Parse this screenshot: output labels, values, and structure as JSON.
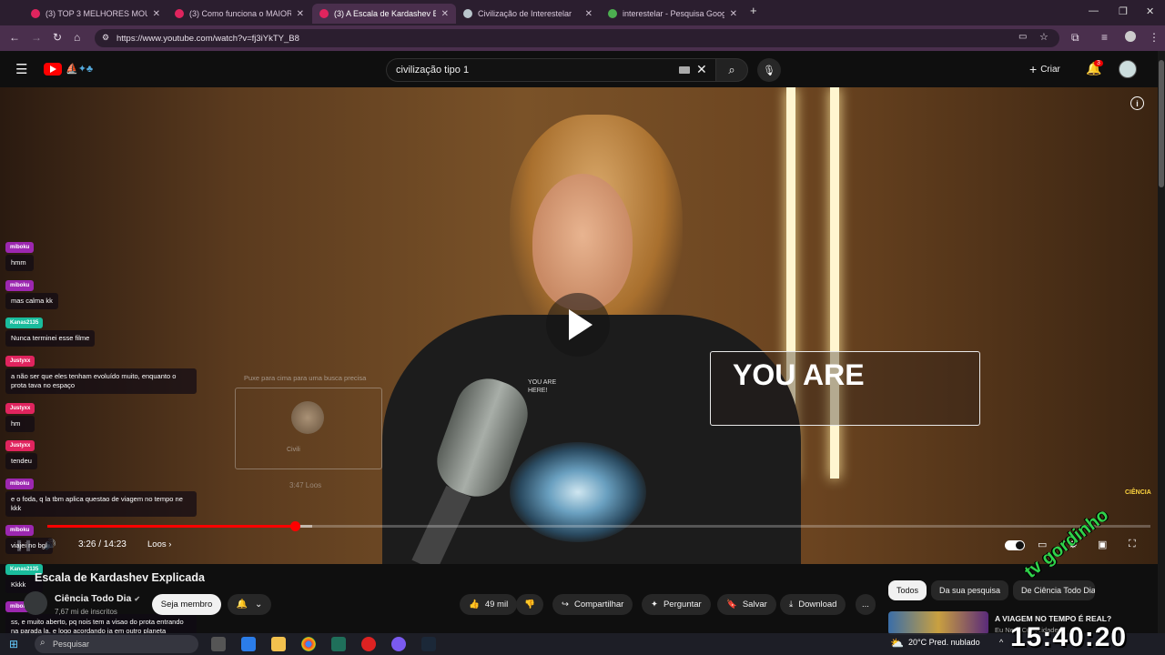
{
  "browser": {
    "tabs": [
      {
        "label": "(3) TOP 3 MELHORES MOUSES",
        "favicon_color": "#e0245e",
        "active": false
      },
      {
        "label": "(3) Como funciona o MAIOR TE",
        "favicon_color": "#e0245e",
        "active": false
      },
      {
        "label": "(3) A Escala de Kardashev E",
        "favicon_color": "#e0245e",
        "active": true
      },
      {
        "label": "Civilização de Interestelar",
        "favicon_color": "#b9c6cc",
        "active": false
      },
      {
        "label": "interestelar - Pesquisa Google",
        "favicon_color": "#4caf50",
        "active": false
      }
    ],
    "new_tab": "+",
    "url": "https://www.youtube.com/watch?v=fj3iYkTY_B8"
  },
  "youtube": {
    "search_value": "civilização tipo 1",
    "create_label": "Criar",
    "notification_count": "3"
  },
  "video": {
    "overlay_text": "YOU ARE",
    "shirt_text": "YOU ARE\nHERE!",
    "hint_text": "Puxe para cima para uma busca precisa",
    "hint_civil": "Civili",
    "hint_loos": "3:47  Loos",
    "progress_fraction": 0.2247,
    "buffer_fraction": 0.24,
    "time_current": "3:26",
    "time_total": "14:23",
    "timecode": "3:26 / 14:23",
    "chapter": "Loos",
    "brand": "CIÊNCIA"
  },
  "chat": [
    {
      "user": "miboku",
      "text": "hmm",
      "color": "#9c27b0"
    },
    {
      "user": "miboku",
      "text": "mas calma kk",
      "color": "#9c27b0"
    },
    {
      "user": "Kanas2135",
      "text": "Nunca terminei esse filme",
      "color": "#1abc9c"
    },
    {
      "user": "Justyxx",
      "text": "a não ser que eles tenham evoluído muito, enquanto o prota tava no espaço",
      "color": "#e0245e"
    },
    {
      "user": "Justyxx",
      "text": "hm",
      "color": "#e0245e"
    },
    {
      "user": "Justyxx",
      "text": "tendeu",
      "color": "#e0245e"
    },
    {
      "user": "miboku",
      "text": "e o foda, q la tbm aplica questao de viagem no tempo ne kkk",
      "color": "#9c27b0"
    },
    {
      "user": "miboku",
      "text": "viajei no bgl",
      "color": "#9c27b0"
    },
    {
      "user": "Kanas2135",
      "text": "Kkkk",
      "color": "#1abc9c"
    },
    {
      "user": "miboku",
      "text": "ss, e muito aberto, pq nois tem a visao do prota entrando na parada la, e logo acordando ja em outro planeta",
      "color": "#9c27b0"
    }
  ],
  "below": {
    "title": "Escala de Kardashev Explicada",
    "channel": "Ciência Todo Dia",
    "subs": "7,67 mi de inscritos",
    "join": "Seja membro",
    "likes": "49 mil",
    "share": "Compartilhar",
    "ask": "Perguntar",
    "save": "Salvar",
    "download": "Download",
    "more": "...",
    "filters": [
      "Todos",
      "Da sua pesquisa",
      "De Ciência Todo Dia"
    ],
    "rec_title": "A VIAGEM NO TEMPO É REAL?",
    "rec_sub": "Eu Nerd Curiosidades"
  },
  "taskbar": {
    "search_placeholder": "Pesquisar",
    "weather": "20°C  Pred. nublado",
    "clock": "15:40:20"
  },
  "watermark": "tv gordinho"
}
